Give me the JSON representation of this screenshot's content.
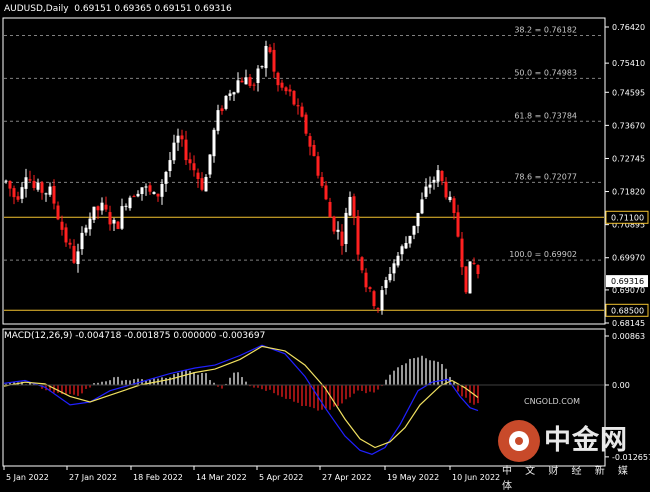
{
  "header": {
    "symbol": "AUDUSD,Daily",
    "ohlc": "0.69151 0.69365 0.69151 0.69316"
  },
  "macd": {
    "label": "MACD(12,26,9) -0.004718 -0.001875 0.000000 -0.003697",
    "scale_top": "0.00863",
    "scale_mid": "0.00",
    "scale_bottom": "-0.012657"
  },
  "price_axis": [
    "0.76420",
    "0.75410",
    "0.74595",
    "0.73670",
    "0.72745",
    "0.71820",
    "0.70895",
    "0.69970",
    "0.69070",
    "0.68145"
  ],
  "current_price_label": "0.69316",
  "fib_levels": [
    {
      "label": "38.2 = 0.76182",
      "price": 0.76182
    },
    {
      "label": "50.0 = 0.74983",
      "price": 0.74983
    },
    {
      "label": "61.8 = 0.73784",
      "price": 0.73784
    },
    {
      "label": "78.6 = 0.72077",
      "price": 0.72077
    },
    {
      "label": "100.0 = 0.69902",
      "price": 0.69902
    }
  ],
  "hlines": [
    {
      "label": "0.71100",
      "price": 0.711,
      "color": "#f2c230"
    },
    {
      "label": "0.68500",
      "price": 0.685,
      "color": "#f2c230"
    }
  ],
  "time_axis": [
    "5 Jan 2022",
    "27 Jan 2022",
    "18 Feb 2022",
    "14 Mar 2022",
    "5 Apr 2022",
    "27 Apr 2022",
    "19 May 2022",
    "10 Jun 2022"
  ],
  "watermark": {
    "title": "中金网",
    "subtitle": "中 文 财 经 新 媒 体",
    "url": "CNGOLD.COM"
  },
  "colors": {
    "up": "#ffffff",
    "down": "#ff2020",
    "macd_signal": "#2020ff",
    "macd_line": "#f0e060",
    "grid": "#808080"
  }
}
